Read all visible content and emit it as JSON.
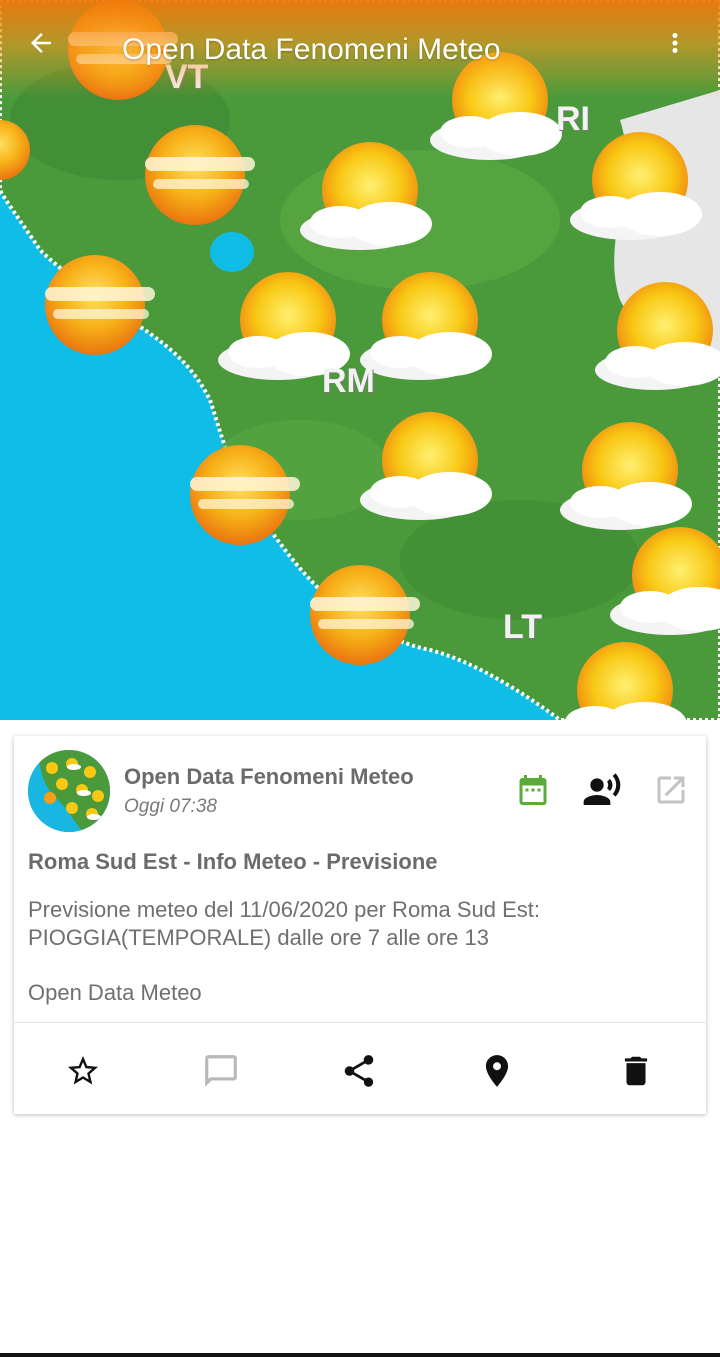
{
  "appbar": {
    "title": "Open Data Fenomeni Meteo",
    "back_icon": "arrow-back-icon",
    "menu_icon": "more-vert-icon"
  },
  "map": {
    "labels": [
      "VT",
      "RI",
      "RM",
      "LT"
    ],
    "colors": {
      "sea": "#10bde6",
      "land": "#4a9a3c",
      "sun": "#f8c814",
      "cloud": "#f2f2f2"
    }
  },
  "card": {
    "source_name": "Open Data Fenomeni Meteo",
    "timestamp": "Oggi 07:38",
    "headline": "Roma Sud Est - Info Meteo - Previsione",
    "body_lines": [
      "Previsione meteo del 11/06/2020 per Roma Sud Est:",
      "PIOGGIA(TEMPORALE) dalle ore 7 alle ore 13"
    ],
    "footer_source": "Open Data Meteo",
    "header_icons": [
      "calendar-icon",
      "record-voice-icon",
      "open-external-icon"
    ],
    "accent_color": "#5aab3c",
    "actions": [
      "star-icon",
      "comment-icon",
      "share-icon",
      "location-pin-icon",
      "delete-icon"
    ]
  }
}
